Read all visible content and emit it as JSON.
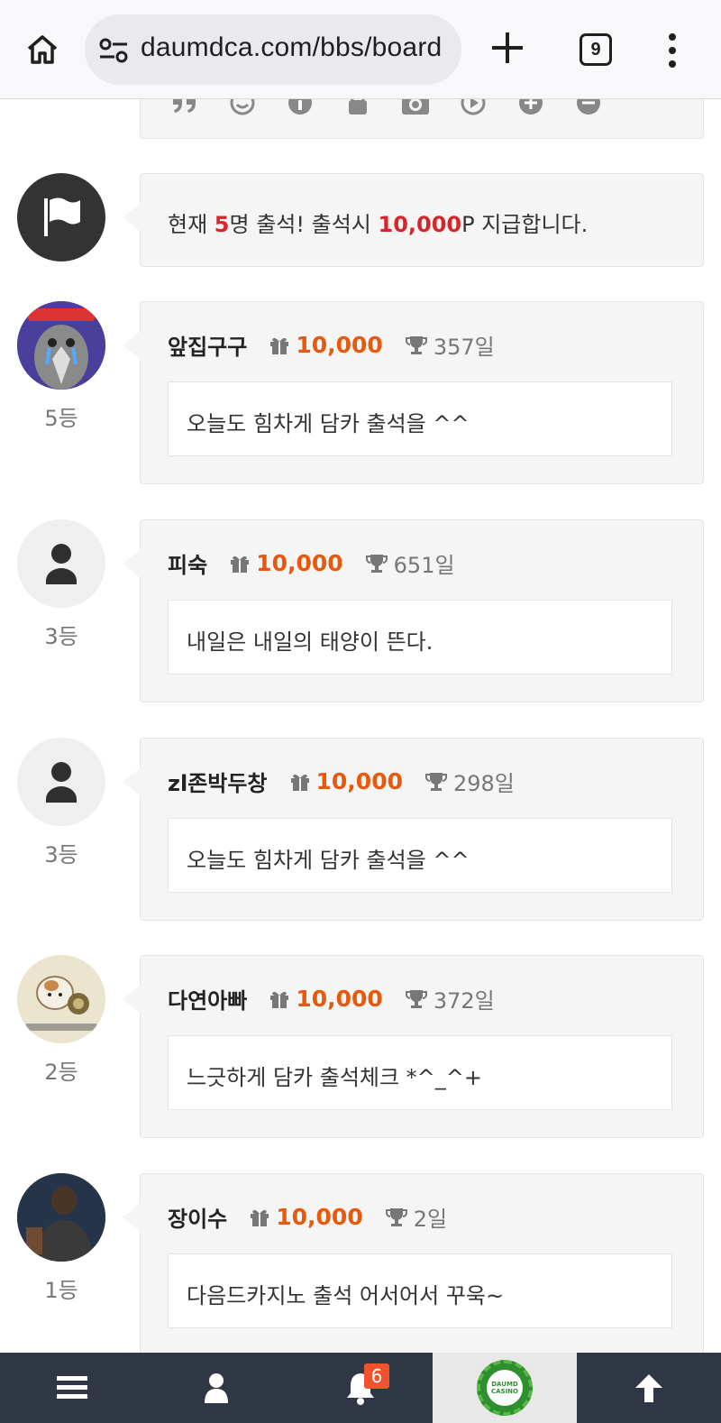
{
  "browser": {
    "url": "daumdca.com/bbs/board",
    "tab_count": "9"
  },
  "notice": {
    "prefix": "현재 ",
    "count": "5",
    "middle": "명 출석! 출석시 ",
    "points": "10,000",
    "suffix": "P 지급합니다."
  },
  "entries": [
    {
      "nick": "앞집구구",
      "points": "10,000",
      "days": "357일",
      "message": "오늘도 힘차게 담카 출석을 ^^",
      "rank": "5등",
      "avatar": "image"
    },
    {
      "nick": "피숙",
      "points": "10,000",
      "days": "651일",
      "message": "내일은 내일의 태양이 뜬다.",
      "rank": "3등",
      "avatar": "default"
    },
    {
      "nick": "zl존박두창",
      "points": "10,000",
      "days": "298일",
      "message": "오늘도 힘차게 담카 출석을 ^^",
      "rank": "3등",
      "avatar": "default"
    },
    {
      "nick": "다연아빠",
      "points": "10,000",
      "days": "372일",
      "message": "느긋하게 담카 출석체크 *^_^+",
      "rank": "2등",
      "avatar": "image"
    },
    {
      "nick": "장이수",
      "points": "10,000",
      "days": "2일",
      "message": "다음드카지노 출석 어서어서 꾸욱~",
      "rank": "1등",
      "avatar": "image"
    }
  ],
  "bottom_nav": {
    "notification_count": "6",
    "logo_text": "DAUMD CASINO"
  },
  "colors": {
    "accent_points": "#e8590c",
    "notice_red": "#d6262b",
    "nav_bg": "#2e3743"
  }
}
